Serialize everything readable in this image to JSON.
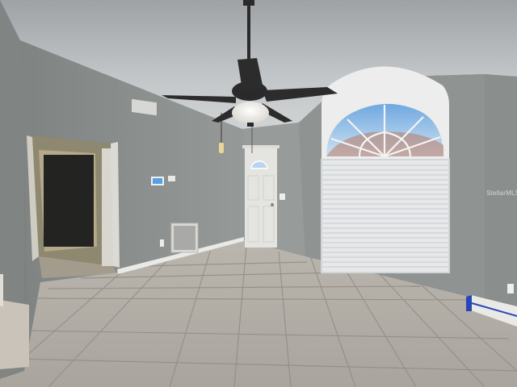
{
  "scene": {
    "watermark": "StellarMLS",
    "colors": {
      "ceiling": "#c4c8ca",
      "wall_left": "#8a8e8c",
      "wall_back": "#979b99",
      "wall_right": "#8f9392",
      "floor": "#b3afa8",
      "grout": "#8f8b84",
      "door": "#e4e4e1",
      "baseboard": "#e9e9e6",
      "blinds": "#e6e8ea",
      "sky": "#8fbbe6",
      "fan": "#2a2a2b",
      "blue_tape": "#2846b8"
    }
  }
}
